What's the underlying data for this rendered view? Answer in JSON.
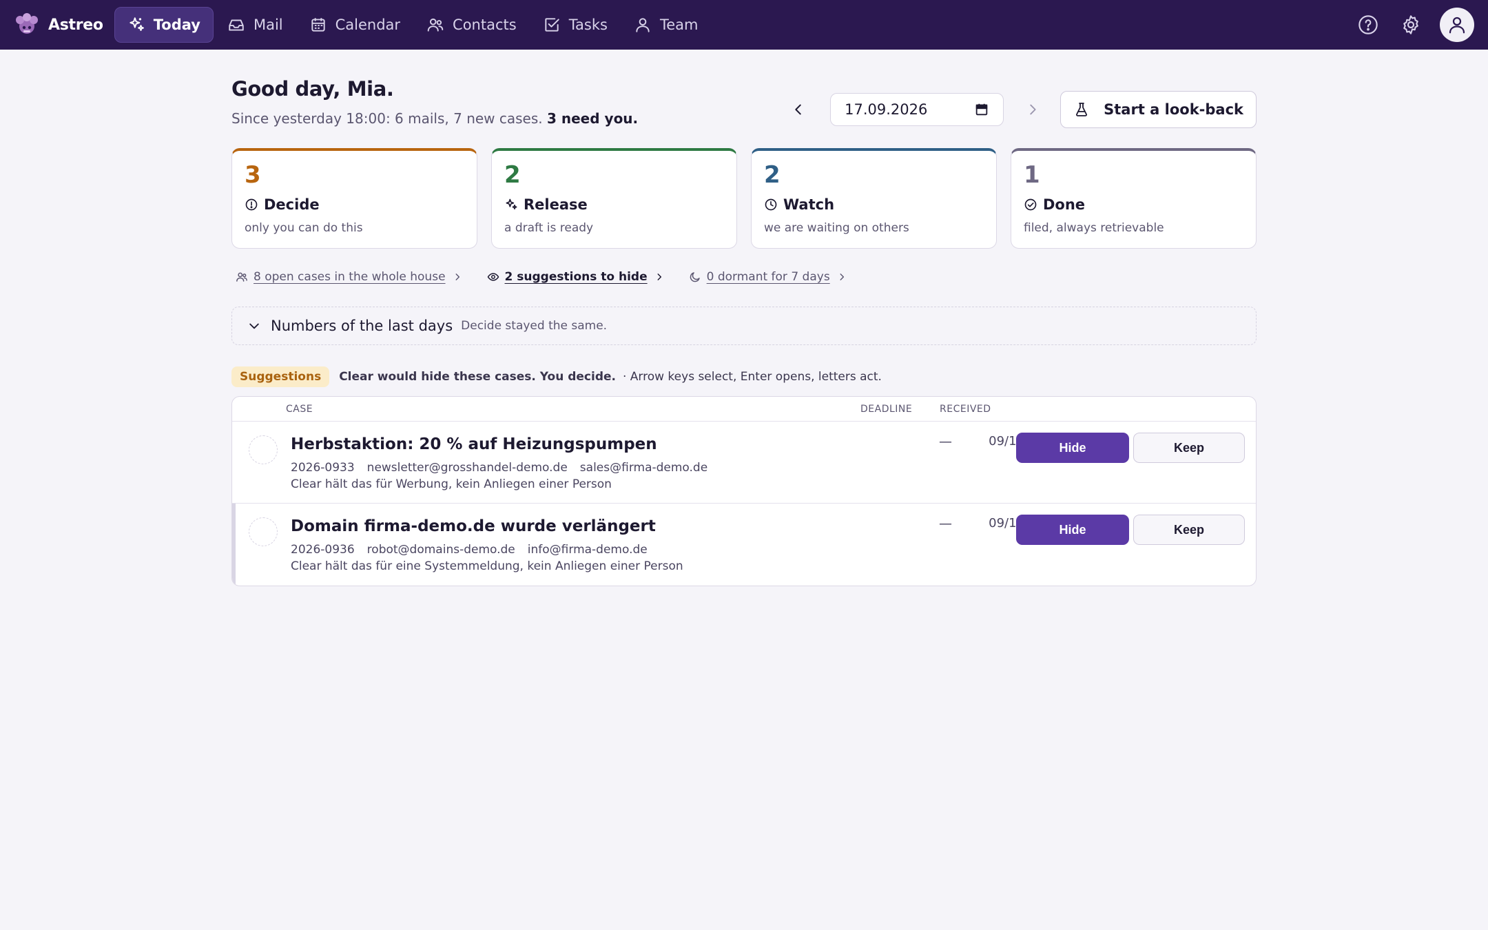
{
  "app": {
    "name": "Astreo"
  },
  "nav": {
    "items": [
      {
        "label": "Today",
        "icon": "sparkles-icon",
        "active": true
      },
      {
        "label": "Mail",
        "icon": "inbox-icon",
        "active": false
      },
      {
        "label": "Calendar",
        "icon": "calendar-icon",
        "active": false
      },
      {
        "label": "Contacts",
        "icon": "users-icon",
        "active": false
      },
      {
        "label": "Tasks",
        "icon": "checkbox-icon",
        "active": false
      },
      {
        "label": "Team",
        "icon": "user-icon",
        "active": false
      }
    ]
  },
  "header": {
    "greeting": "Good day, Mia.",
    "summary": "Since yesterday 18:00: 6 mails, 7 new cases.",
    "summary_strong": "3 need you.",
    "date": "17.09.2026",
    "lookback_label": "Start a look-back"
  },
  "cards": [
    {
      "count": "3",
      "label": "Decide",
      "desc": "only you can do this",
      "color": "#b8650f",
      "icon": "alert-circle-icon"
    },
    {
      "count": "2",
      "label": "Release",
      "desc": "a draft is ready",
      "color": "#2e7a43",
      "icon": "sparkles-icon"
    },
    {
      "count": "2",
      "label": "Watch",
      "desc": "we are waiting on others",
      "color": "#2f5f86",
      "icon": "clock-icon"
    },
    {
      "count": "1",
      "label": "Done",
      "desc": "filed, always retrievable",
      "color": "#6e6883",
      "icon": "check-circle-icon"
    }
  ],
  "links": {
    "open_cases": "8 open cases in the whole house",
    "suggestions": "2 suggestions to hide",
    "dormant": "0 dormant for 7 days"
  },
  "numbers": {
    "title": "Numbers of the last days",
    "hint": "Decide stayed the same."
  },
  "suggestions": {
    "badge": "Suggestions",
    "text": "Clear would hide these cases. You decide.",
    "keys_hint": "· Arrow keys select, Enter opens, letters act."
  },
  "table": {
    "columns": {
      "case": "CASE",
      "deadline": "DEADLINE",
      "received": "RECEIVED"
    },
    "rows": [
      {
        "title": "Herbstaktion: 20 % auf Heizungspumpen",
        "id": "2026-0933",
        "from": "newsletter@grosshandel-demo.de",
        "to": "sales@firma-demo.de",
        "reason": "Clear hält das für Werbung, kein Anliegen einer Person",
        "deadline": "—",
        "received": "09/17",
        "hide_label": "Hide",
        "keep_label": "Keep"
      },
      {
        "title": "Domain firma-demo.de wurde verlängert",
        "id": "2026-0936",
        "from": "robot@domains-demo.de",
        "to": "info@firma-demo.de",
        "reason": "Clear hält das für eine Systemmeldung, kein Anliegen einer Person",
        "deadline": "—",
        "received": "09/17",
        "hide_label": "Hide",
        "keep_label": "Keep"
      }
    ]
  },
  "colors": {
    "topbar": "#2b1850",
    "accent": "#5b3aa6",
    "background": "#f5f4f9"
  }
}
